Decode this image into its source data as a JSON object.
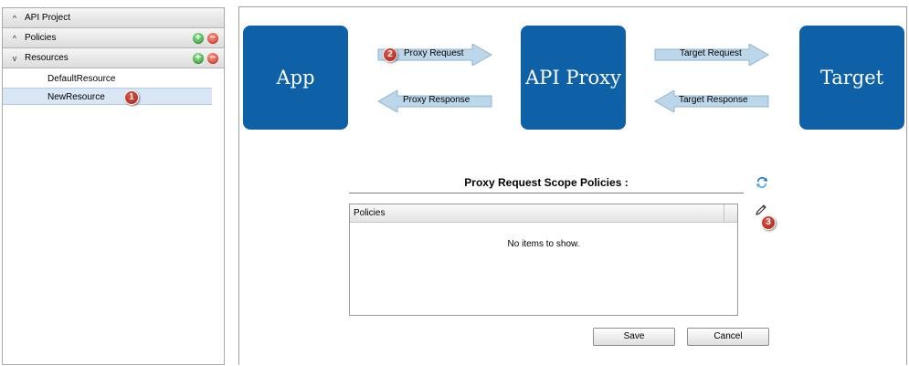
{
  "tree": {
    "sections": [
      {
        "label": "API Project",
        "chevron": "^"
      },
      {
        "label": "Policies",
        "chevron": "^"
      },
      {
        "label": "Resources",
        "chevron": "v"
      }
    ],
    "resources": [
      "DefaultResource",
      "NewResource"
    ]
  },
  "flow": {
    "boxes": [
      "App",
      "API Proxy",
      "Target"
    ],
    "arrows": {
      "proxy_request": "Proxy Request",
      "proxy_response": "Proxy Response",
      "target_request": "Target Request",
      "target_response": "Target Response"
    }
  },
  "scope": {
    "title": "Proxy Request Scope Policies :",
    "column": "Policies",
    "empty_text": "No items to show."
  },
  "buttons": {
    "save": "Save",
    "cancel": "Cancel"
  },
  "markers": [
    "1",
    "2",
    "3"
  ],
  "icons": {
    "add": "+",
    "remove": "−",
    "refresh": "refresh-icon",
    "edit": "pencil-icon"
  },
  "colors": {
    "box": "#0e61a6",
    "arrow": "#bcd6ea",
    "selected": "#d8e6f5"
  }
}
